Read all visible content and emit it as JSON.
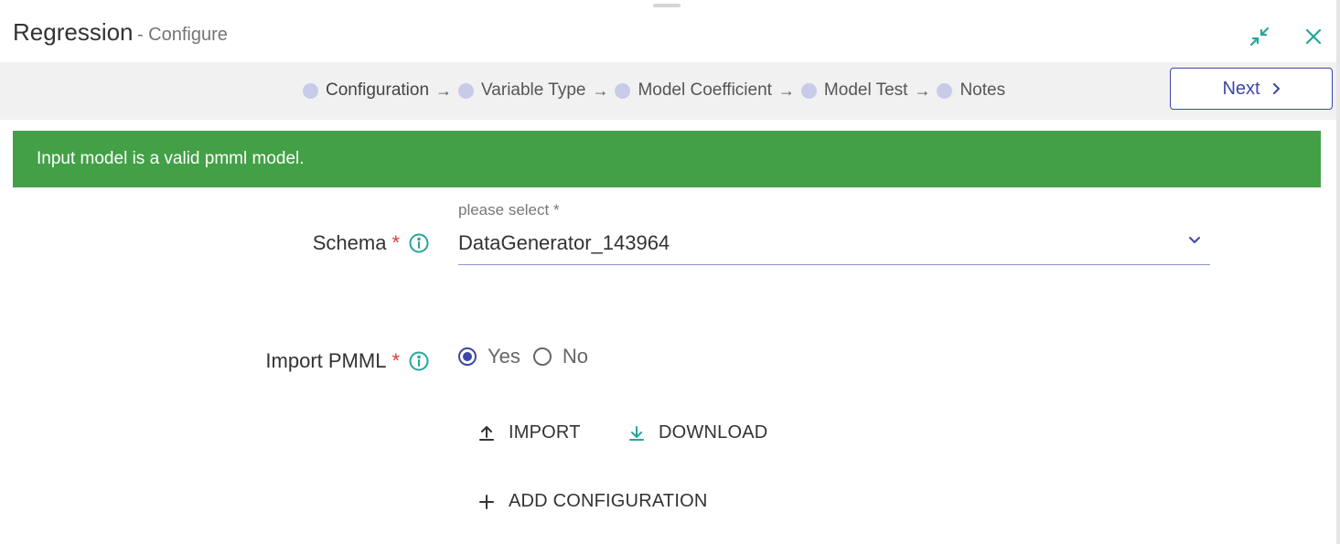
{
  "header": {
    "title": "Regression",
    "subtitle": "- Configure"
  },
  "window_controls": {
    "collapse_icon": "collapse-icon",
    "close_icon": "close-icon",
    "accent_color": "#26a69a"
  },
  "stepper": {
    "steps": [
      {
        "label": "Configuration",
        "active": true
      },
      {
        "label": "Variable Type",
        "active": false
      },
      {
        "label": "Model Coefficient",
        "active": false
      },
      {
        "label": "Model Test",
        "active": false
      },
      {
        "label": "Notes",
        "active": false
      }
    ],
    "separator": "→",
    "next_label": "Next"
  },
  "alert": {
    "message": "Input model is a valid pmml model.",
    "color": "#43a047"
  },
  "form": {
    "schema": {
      "label": "Schema",
      "required_mark": "*",
      "hint": "please select *",
      "value": "DataGenerator_143964"
    },
    "import_pmml": {
      "label": "Import PMML",
      "required_mark": "*",
      "options": [
        {
          "label": "Yes",
          "checked": true
        },
        {
          "label": "No",
          "checked": false
        }
      ]
    },
    "actions": {
      "import_label": "IMPORT",
      "download_label": "DOWNLOAD",
      "add_configuration_label": "ADD CONFIGURATION"
    }
  },
  "colors": {
    "primary": "#3c48a4",
    "required": "#e53935",
    "teal": "#26a69a"
  }
}
